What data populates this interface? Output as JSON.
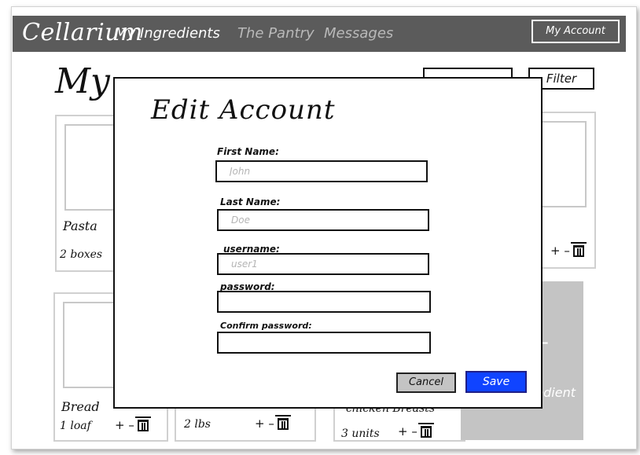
{
  "nav": {
    "brand": "Cellarium",
    "links": [
      "My Ingredients",
      "The Pantry",
      "Messages"
    ],
    "account_button": "My Account"
  },
  "page": {
    "title_visible": "My",
    "filter_label": "Filter"
  },
  "cards": {
    "pasta": {
      "name": "Pasta",
      "qty": "2 boxes"
    },
    "bread": {
      "name": "Bread",
      "qty": "1 loaf"
    },
    "card3": {
      "qty": "2 lbs"
    },
    "chicken": {
      "name": "chicken Breasts",
      "qty": "3 units"
    },
    "right_controls": "+ –",
    "add_partial_label": "redient"
  },
  "modal": {
    "title": "Edit Account",
    "fields": {
      "first_name": {
        "label": "First Name:",
        "placeholder": "John"
      },
      "last_name": {
        "label": "Last Name:",
        "placeholder": "Doe"
      },
      "username": {
        "label": "username:",
        "placeholder": "user1"
      },
      "password": {
        "label": "password:",
        "placeholder": ""
      },
      "confirm_password": {
        "label": "Confirm password:",
        "placeholder": ""
      }
    },
    "cancel_label": "Cancel",
    "save_label": "Save"
  },
  "colors": {
    "navbar": "#5b5b5b",
    "save_button": "#1044ff",
    "cancel_button": "#c4c4c4",
    "add_card": "#c4c4c4"
  },
  "icons": [
    "trash-icon",
    "plus-icon",
    "minus-icon"
  ]
}
